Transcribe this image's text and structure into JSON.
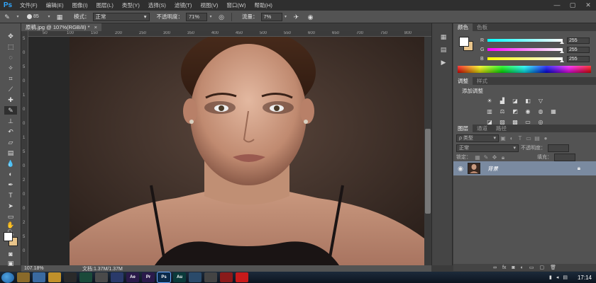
{
  "app": {
    "logo": "Ps",
    "menu": [
      "文件(F)",
      "编辑(E)",
      "图像(I)",
      "图层(L)",
      "类型(Y)",
      "选择(S)",
      "滤镜(T)",
      "视图(V)",
      "窗口(W)",
      "帮助(H)"
    ],
    "window_controls": [
      "—",
      "▢",
      "✕"
    ]
  },
  "options": {
    "brush_size": "85",
    "mode_label": "模式：",
    "mode_value": "正常",
    "opacity_label": "不透明度：",
    "opacity_value": "71%",
    "flow_label": "流量：",
    "flow_value": "7%",
    "icons": [
      "brush-icon",
      "brush-panel-icon",
      "pressure-opacity-icon",
      "airbrush-icon",
      "pressure-size-icon"
    ]
  },
  "document": {
    "tab_title": "原稿.jpg @ 107%(RGB/8) *",
    "tab_close": "×",
    "ruler_top": [
      "50",
      "100",
      "150",
      "200",
      "250",
      "300",
      "350",
      "400",
      "450",
      "500",
      "550",
      "600",
      "650",
      "700",
      "750",
      "800"
    ],
    "ruler_left": [
      "5",
      "0",
      "5",
      "0",
      "1",
      "0",
      "0",
      "1",
      "5",
      "0",
      "2",
      "0",
      "0",
      "2",
      "5",
      "0"
    ],
    "zoom": "107.18%",
    "doc_size": "文档:1.37M/1.37M"
  },
  "tools": [
    "move-tool-icon",
    "marquee-tool-icon",
    "lasso-tool-icon",
    "quick-select-tool-icon",
    "crop-tool-icon",
    "eyedropper-tool-icon",
    "healing-brush-tool-icon",
    "brush-tool-icon",
    "clone-stamp-tool-icon",
    "history-brush-tool-icon",
    "eraser-tool-icon",
    "gradient-tool-icon",
    "blur-tool-icon",
    "dodge-tool-icon",
    "pen-tool-icon",
    "type-tool-icon",
    "path-select-tool-icon",
    "rectangle-tool-icon",
    "hand-tool-icon",
    "zoom-tool-icon"
  ],
  "color_panel": {
    "tabs": [
      "颜色",
      "色板"
    ],
    "channels": [
      {
        "name": "R",
        "value": "255",
        "gradient": [
          "#00ffff",
          "#ffffff"
        ]
      },
      {
        "name": "G",
        "value": "255",
        "gradient": [
          "#ff00ff",
          "#ffffff"
        ]
      },
      {
        "name": "B",
        "value": "255",
        "gradient": [
          "#ffff00",
          "#ffffff"
        ]
      }
    ],
    "foreground": "#ffffff",
    "background": "#e8c48a"
  },
  "adjustments": {
    "tabs": [
      "调整",
      "样式"
    ],
    "title": "添加调整"
  },
  "layers": {
    "tabs": [
      "图层",
      "通道",
      "路径"
    ],
    "filter_label": "ρ 类型",
    "blend_mode": "正常",
    "opacity_label": "不透明度：",
    "lock_label": "锁定：",
    "fill_label": "填充：",
    "layer_name": "背景"
  },
  "taskbar": {
    "apps": [
      {
        "label": "Ae",
        "color": "#2a1a4a"
      },
      {
        "label": "Pr",
        "color": "#2a1a4a"
      },
      {
        "label": "Ps",
        "color": "#0a2a4a"
      },
      {
        "label": "Au",
        "color": "#0a3a3a"
      },
      {
        "label": "",
        "color": "#2a4a6a"
      },
      {
        "label": "",
        "color": "#444444"
      },
      {
        "label": "",
        "color": "#8a1a1a"
      },
      {
        "label": "",
        "color": "#c81a1a"
      }
    ],
    "clock": "17:14"
  }
}
